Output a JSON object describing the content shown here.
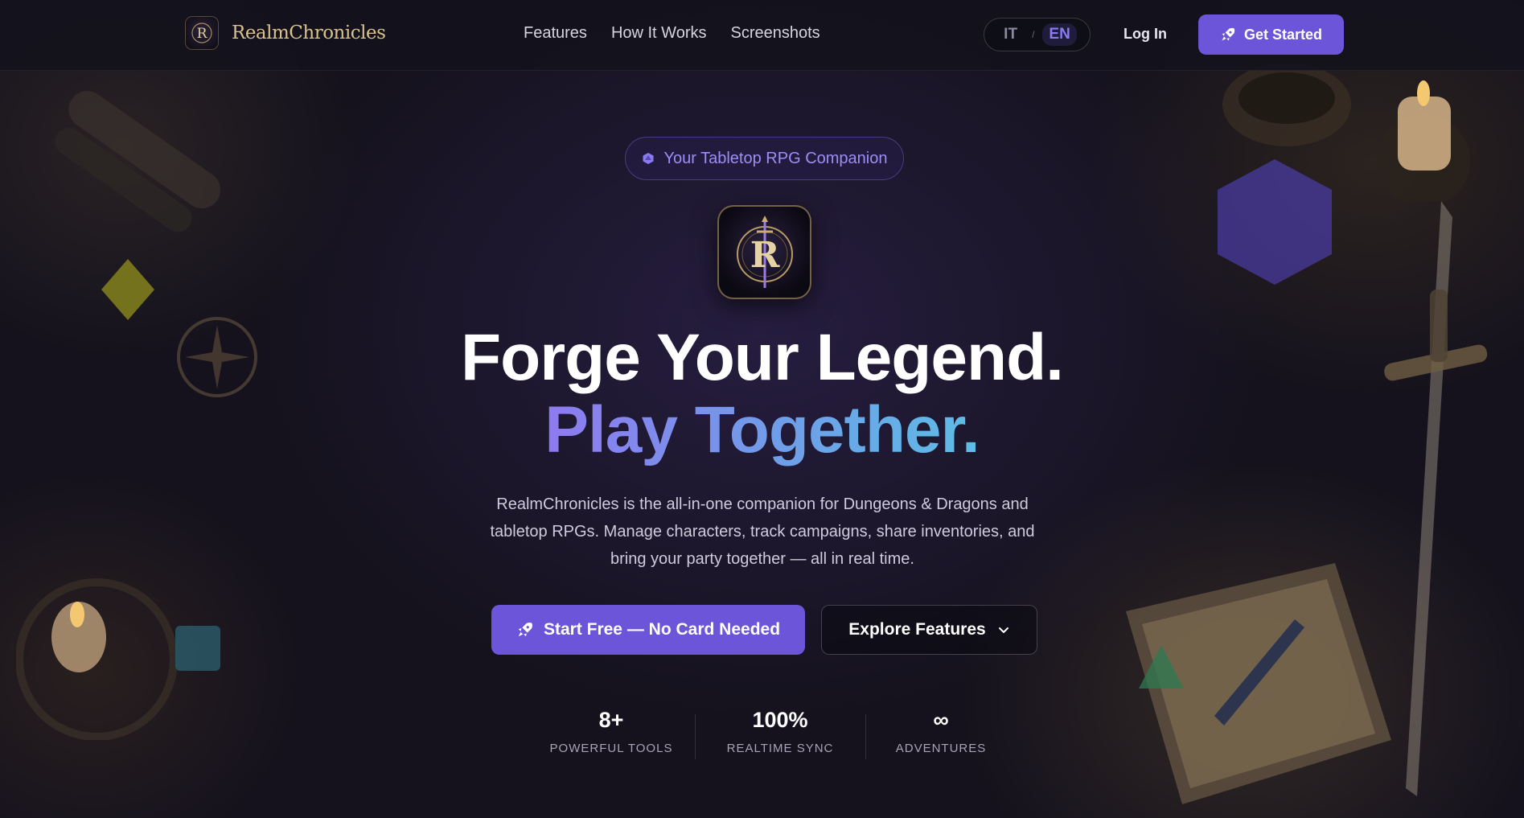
{
  "nav": {
    "brand": "RealmChronicles",
    "brand_logo_letter": "R",
    "links": [
      "Features",
      "How It Works",
      "Screenshots"
    ],
    "lang": {
      "options": [
        "IT",
        "EN"
      ],
      "separator": "/",
      "active": "EN"
    },
    "login": "Log In",
    "cta": "Get Started",
    "cta_icon": "rocket-icon"
  },
  "hero": {
    "badge": "Your Tabletop RPG Companion",
    "badge_icon": "d20-icon",
    "logo_letter": "R",
    "headline_line1": "Forge Your Legend.",
    "headline_line2": "Play Together.",
    "description": "RealmChronicles is the all-in-one companion for Dungeons & Dragons and tabletop RPGs. Manage characters, track campaigns, share inventories, and bring your party together — all in real time.",
    "primary_button": "Start Free — No Card Needed",
    "secondary_button": "Explore Features",
    "secondary_icon": "chevron-down-icon"
  },
  "stats": [
    {
      "value": "8+",
      "label": "POWERFUL TOOLS"
    },
    {
      "value": "100%",
      "label": "REALTIME SYNC"
    },
    {
      "value": "∞",
      "label": "ADVENTURES"
    }
  ],
  "colors": {
    "accent": "#6d55d9",
    "gradient_start": "#8e7af0",
    "gradient_end": "#5dbde6",
    "gold": "#d9c28c",
    "background": "#15121d"
  }
}
